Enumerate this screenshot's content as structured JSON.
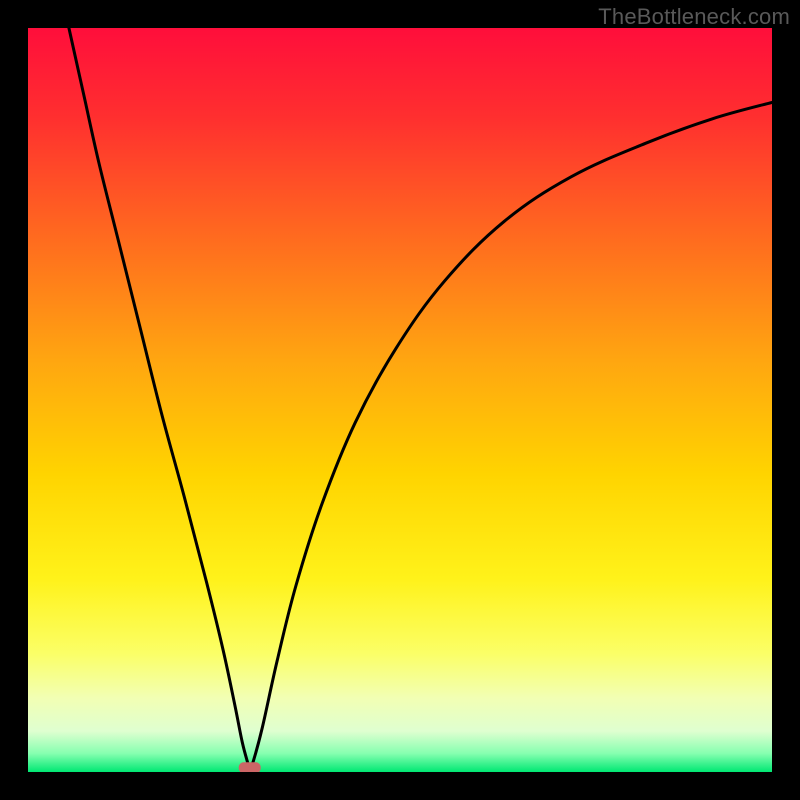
{
  "watermark": "TheBottleneck.com",
  "chart_data": {
    "type": "line",
    "title": "",
    "xlabel": "",
    "ylabel": "",
    "xlim": [
      0,
      1
    ],
    "ylim": [
      0,
      1
    ],
    "dip_x": 0.298,
    "marker": {
      "x": 0.298,
      "y": 0.005,
      "color": "#cc6666"
    },
    "gradient_stops": [
      {
        "offset": 0.0,
        "color": "#ff0e3b"
      },
      {
        "offset": 0.12,
        "color": "#ff2f2f"
      },
      {
        "offset": 0.28,
        "color": "#ff6a1f"
      },
      {
        "offset": 0.45,
        "color": "#ffa710"
      },
      {
        "offset": 0.6,
        "color": "#ffd400"
      },
      {
        "offset": 0.74,
        "color": "#fff21a"
      },
      {
        "offset": 0.84,
        "color": "#fbff66"
      },
      {
        "offset": 0.9,
        "color": "#f2ffb3"
      },
      {
        "offset": 0.945,
        "color": "#dfffd0"
      },
      {
        "offset": 0.975,
        "color": "#86ffb0"
      },
      {
        "offset": 1.0,
        "color": "#00e873"
      }
    ],
    "series": [
      {
        "name": "curve",
        "segment": "left",
        "points": [
          {
            "x": 0.055,
            "y": 1.0
          },
          {
            "x": 0.075,
            "y": 0.91
          },
          {
            "x": 0.095,
            "y": 0.82
          },
          {
            "x": 0.12,
            "y": 0.72
          },
          {
            "x": 0.15,
            "y": 0.6
          },
          {
            "x": 0.18,
            "y": 0.48
          },
          {
            "x": 0.21,
            "y": 0.37
          },
          {
            "x": 0.24,
            "y": 0.255
          },
          {
            "x": 0.262,
            "y": 0.165
          },
          {
            "x": 0.278,
            "y": 0.09
          },
          {
            "x": 0.288,
            "y": 0.04
          },
          {
            "x": 0.296,
            "y": 0.01
          },
          {
            "x": 0.298,
            "y": 0.003
          }
        ]
      },
      {
        "name": "curve",
        "segment": "right",
        "points": [
          {
            "x": 0.298,
            "y": 0.003
          },
          {
            "x": 0.303,
            "y": 0.015
          },
          {
            "x": 0.315,
            "y": 0.06
          },
          {
            "x": 0.335,
            "y": 0.15
          },
          {
            "x": 0.36,
            "y": 0.25
          },
          {
            "x": 0.395,
            "y": 0.36
          },
          {
            "x": 0.44,
            "y": 0.47
          },
          {
            "x": 0.495,
            "y": 0.57
          },
          {
            "x": 0.56,
            "y": 0.66
          },
          {
            "x": 0.64,
            "y": 0.74
          },
          {
            "x": 0.73,
            "y": 0.8
          },
          {
            "x": 0.83,
            "y": 0.845
          },
          {
            "x": 0.92,
            "y": 0.878
          },
          {
            "x": 1.0,
            "y": 0.9
          }
        ]
      }
    ]
  }
}
